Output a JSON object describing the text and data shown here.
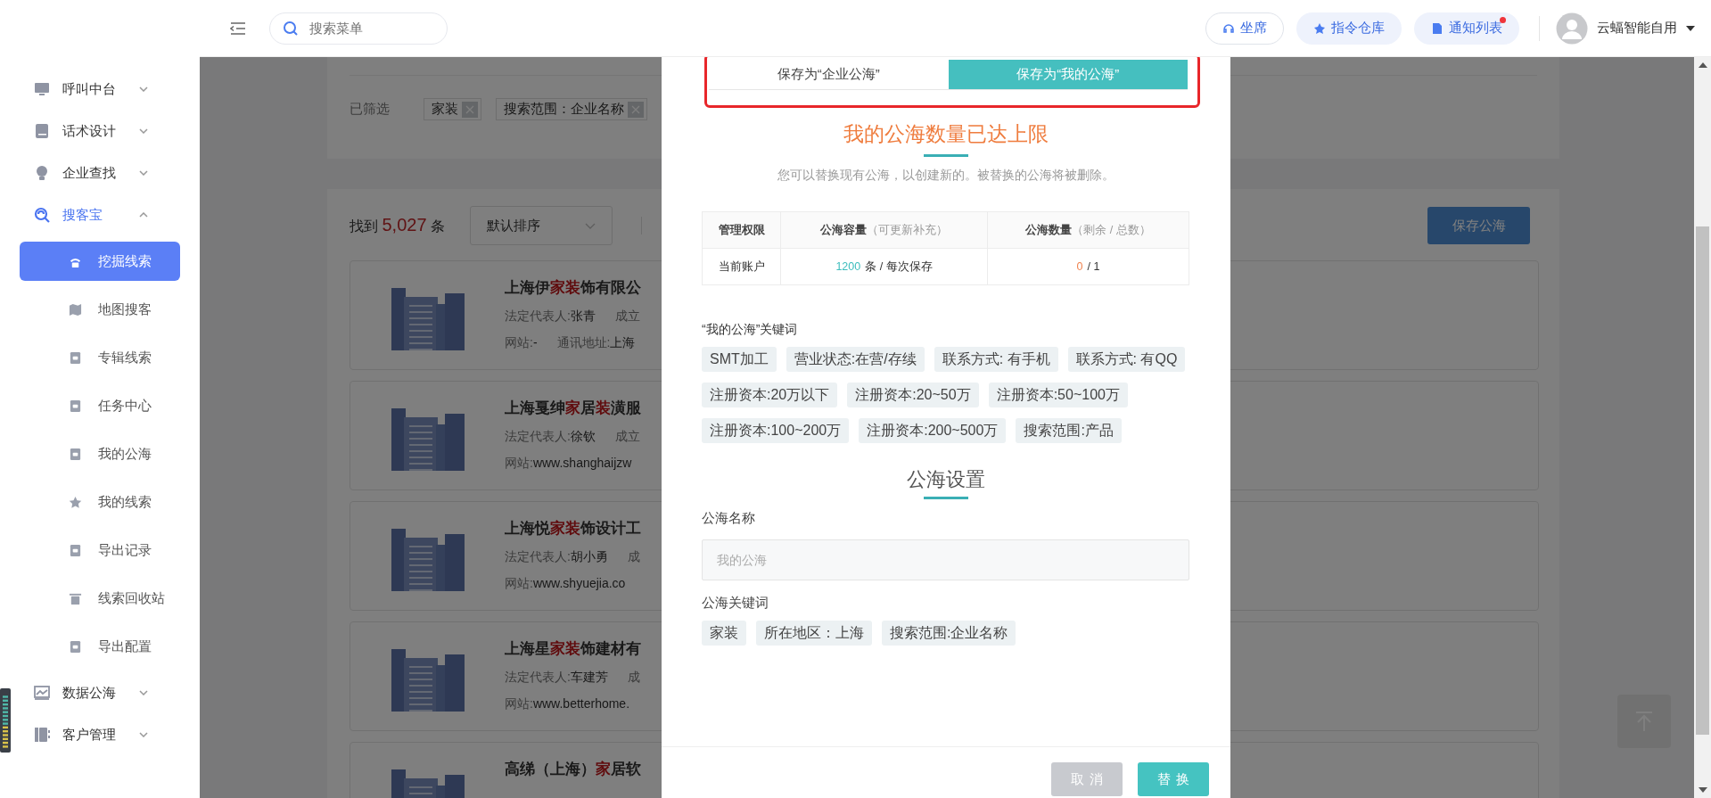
{
  "topbar": {
    "search": {
      "placeholder": "搜索菜单"
    },
    "buttons": [
      {
        "label": "坐席",
        "kind": "outline",
        "badge": false
      },
      {
        "label": "指令仓库",
        "kind": "soft",
        "badge": false
      },
      {
        "label": "通知列表",
        "kind": "soft",
        "badge": true
      }
    ],
    "user": {
      "name": "云蝠智能自用"
    }
  },
  "sidebar": {
    "items": [
      {
        "label": "呼叫中台",
        "expanded": false
      },
      {
        "label": "话术设计",
        "expanded": false
      },
      {
        "label": "企业查找",
        "expanded": false
      },
      {
        "label": "搜客宝",
        "expanded": true,
        "children": [
          {
            "label": "挖掘线索",
            "selected": true
          },
          {
            "label": "地图搜客",
            "selected": false
          },
          {
            "label": "专辑线索",
            "selected": false
          },
          {
            "label": "任务中心",
            "selected": false
          },
          {
            "label": "我的公海",
            "selected": false
          },
          {
            "label": "我的线索",
            "selected": false
          },
          {
            "label": "导出记录",
            "selected": false
          },
          {
            "label": "线索回收站",
            "selected": false
          },
          {
            "label": "导出配置",
            "selected": false
          }
        ]
      },
      {
        "label": "数据公海",
        "expanded": false
      },
      {
        "label": "客户管理",
        "expanded": false
      }
    ]
  },
  "filters": {
    "label": "已筛选",
    "tags": [
      "家装",
      "搜索范围：企业名称"
    ]
  },
  "results": {
    "prefix": "找到",
    "count": "5,027",
    "suffix": "条",
    "sort": "默认排序",
    "save_button": "保存公海",
    "items": [
      {
        "title": [
          {
            "text": "上海伊",
            "highlight": false
          },
          {
            "text": "家装",
            "highlight": true
          },
          {
            "text": "饰有限公",
            "highlight": false
          }
        ],
        "lines": [
          [
            {
              "label": "法定代表人:",
              "value": "张青"
            },
            {
              "label": "成立"
            }
          ],
          [
            {
              "label": "网站:",
              "value": "-"
            },
            {
              "label": "通讯地址:",
              "value": "上海"
            }
          ]
        ]
      },
      {
        "title": [
          {
            "text": "上海戛绅",
            "highlight": false
          },
          {
            "text": "家",
            "highlight": true
          },
          {
            "text": "居",
            "highlight": false
          },
          {
            "text": "装",
            "highlight": true
          },
          {
            "text": "潢服",
            "highlight": false
          }
        ],
        "lines": [
          [
            {
              "label": "法定代表人:",
              "value": "徐钦"
            },
            {
              "label": "成立"
            }
          ],
          [
            {
              "label": "网站:",
              "value": "www.shanghaijzw"
            }
          ]
        ]
      },
      {
        "title": [
          {
            "text": "上海悦",
            "highlight": false
          },
          {
            "text": "家装",
            "highlight": true
          },
          {
            "text": "饰设计工",
            "highlight": false
          }
        ],
        "lines": [
          [
            {
              "label": "法定代表人:",
              "value": "胡小勇"
            },
            {
              "label": "成"
            }
          ],
          [
            {
              "label": "网站:",
              "value": "www.shyuejia.co"
            }
          ]
        ]
      },
      {
        "title": [
          {
            "text": "上海星",
            "highlight": false
          },
          {
            "text": "家装",
            "highlight": true
          },
          {
            "text": "饰建材有",
            "highlight": false
          }
        ],
        "lines": [
          [
            {
              "label": "法定代表人:",
              "value": "车建芳"
            },
            {
              "label": "成"
            }
          ],
          [
            {
              "label": "网站:",
              "value": "www.betterhome."
            }
          ]
        ]
      },
      {
        "title": [
          {
            "text": "高绨（上海）",
            "highlight": false
          },
          {
            "text": "家",
            "highlight": true
          },
          {
            "text": "居软",
            "highlight": false
          }
        ]
      }
    ]
  },
  "dialog": {
    "tabs": [
      {
        "label": "保存为“企业公海”",
        "selected": false
      },
      {
        "label": "保存为“我的公海”",
        "selected": true
      }
    ],
    "annotation_frame": true,
    "title": "我的公海数量已达上限",
    "subtitle": "您可以替换现有公海，以创建新的。被替换的公海将被删除。",
    "table": {
      "columns": [
        {
          "title": "管理权限"
        },
        {
          "title": "公海容量",
          "note": "（可更新补充）"
        },
        {
          "title": "公海数量",
          "note": "（剩余 / 总数）"
        }
      ],
      "rows": [
        [
          {
            "text": "当前账户"
          },
          {
            "value": "1200",
            "color": "#3dbdbd",
            "text": "条 / 每次保存"
          },
          {
            "value": "0",
            "color": "#f0834f",
            "text": "/ 1"
          }
        ]
      ]
    },
    "keywords": {
      "label": "“我的公海”关键词",
      "tags": [
        "SMT加工",
        "营业状态:在营/存续",
        "联系方式: 有手机",
        "联系方式: 有QQ",
        "注册资本:20万以下",
        "注册资本:20~50万",
        "注册资本:50~100万",
        "注册资本:100~200万",
        "注册资本:200~500万",
        "搜索范围:产品"
      ]
    },
    "settings": {
      "title": "公海设置",
      "name_label": "公海名称",
      "name_placeholder": "我的公海",
      "keywords_label": "公海关键词",
      "keywords": [
        "家装",
        "所在地区：上海",
        "搜索范围:企业名称"
      ]
    },
    "buttons": [
      {
        "label": "取消",
        "kind": "cancel"
      },
      {
        "label": "替换",
        "kind": "primary"
      }
    ]
  }
}
